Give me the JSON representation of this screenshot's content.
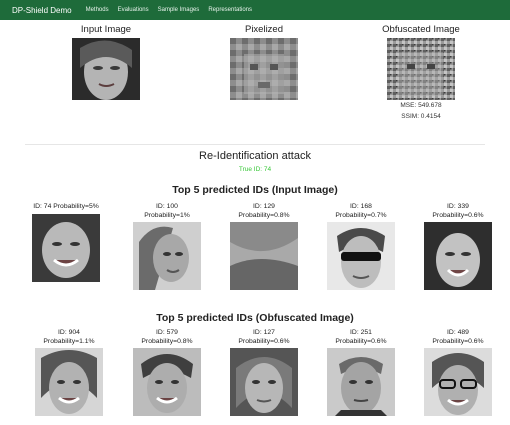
{
  "nav": {
    "brand": "DP-Shield Demo",
    "links": [
      "Methods",
      "Evaluations",
      "Sample Images",
      "Representations"
    ]
  },
  "comparison": {
    "input_label": "Input Image",
    "pixelized_label": "Pixelized",
    "obfuscated_label": "Obfuscated Image",
    "mse": "MSE: 549.678",
    "ssim": "SSIM: 0.4154"
  },
  "attack": {
    "title": "Re-Identification attack",
    "true_id": "True ID: 74"
  },
  "input_predictions": {
    "title": "Top 5 predicted IDs (Input Image)",
    "items": [
      {
        "id": "ID: 74",
        "prob": "Probability=5%"
      },
      {
        "id": "ID: 100",
        "prob": "Probability=1%"
      },
      {
        "id": "ID: 129",
        "prob": "Probability=0.8%"
      },
      {
        "id": "ID: 168",
        "prob": "Probability=0.7%"
      },
      {
        "id": "ID: 339",
        "prob": "Probability=0.6%"
      }
    ]
  },
  "obfuscated_predictions": {
    "title": "Top 5 predicted IDs (Obfuscated Image)",
    "items": [
      {
        "id": "ID: 904",
        "prob": "Probability=1.1%"
      },
      {
        "id": "ID: 579",
        "prob": "Probability=0.8%"
      },
      {
        "id": "ID: 127",
        "prob": "Probability=0.6%"
      },
      {
        "id": "ID: 251",
        "prob": "Probability=0.6%"
      },
      {
        "id": "ID: 489",
        "prob": "Probability=0.6%"
      }
    ]
  },
  "colors": {
    "navbar": "#1e6b3a",
    "true_id": "#37c837"
  }
}
